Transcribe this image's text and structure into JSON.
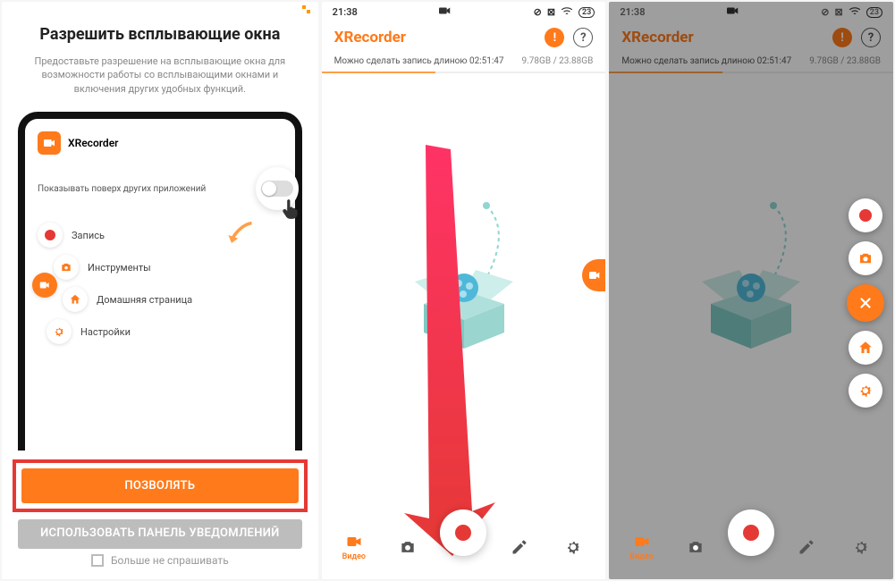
{
  "pane1": {
    "title": "Разрешить всплывающие окна",
    "description": "Предоставьте разрешение на всплывающие окна для возможности работы со всплывающими окнами и включения других удобных функций.",
    "app_name": "XRecorder",
    "overlay_label": "Показывать поверх других приложений",
    "menu": {
      "record": "Запись",
      "tools": "Инструменты",
      "home": "Домашняя страница",
      "settings": "Настройки"
    },
    "allow_btn": "ПОЗВОЛЯТЬ",
    "notif_btn": "ИСПОЛЬЗОВАТЬ ПАНЕЛЬ УВЕДОМЛЕНИЙ",
    "dont_ask": "Больше не спрашивать"
  },
  "status": {
    "time": "21:38",
    "battery": "23"
  },
  "app": {
    "brand": "XRecorder",
    "info_text": "Можно сделать запись длиною 02:51:47",
    "storage": "9.78GB / 23.88GB"
  },
  "nav": {
    "video": "Видео"
  }
}
